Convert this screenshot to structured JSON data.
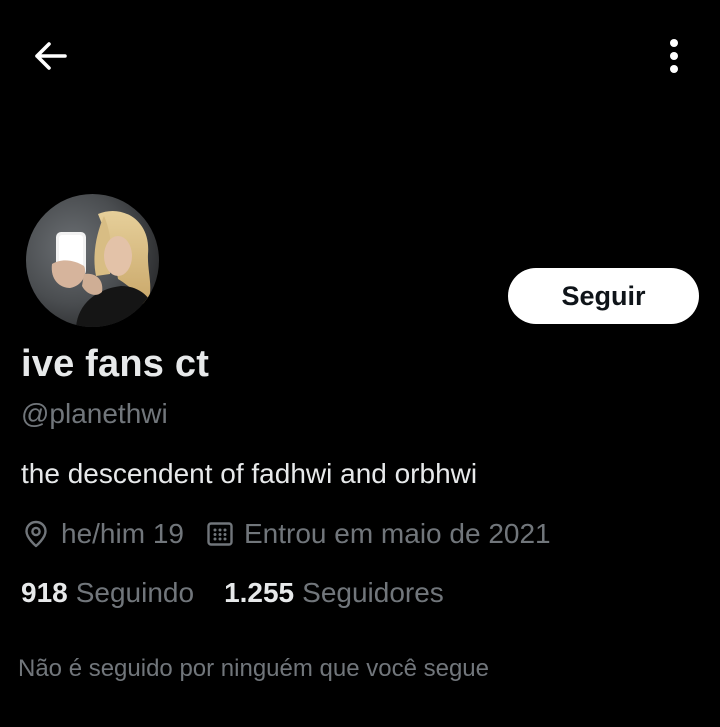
{
  "header": {
    "back_icon": "arrow-left-icon",
    "more_icon": "more-vertical-icon"
  },
  "profile": {
    "avatar_icon": "avatar",
    "follow_label": "Seguir",
    "display_name": "ive fans ct",
    "handle": "@planethwi",
    "bio": "the descendent of fadhwi and orbhwi",
    "location_icon": "location-pin-icon",
    "location": "he/him 19",
    "calendar_icon": "calendar-icon",
    "joined": "Entrou em maio de 2021",
    "following_count": "918",
    "following_label": "Seguindo",
    "followers_count": "1.255",
    "followers_label": "Seguidores",
    "followed_by_text": "Não é seguido por ninguém que você segue"
  },
  "colors": {
    "background": "#000000",
    "primary_text": "#e7e9ea",
    "secondary_text": "#71767b",
    "button_bg": "#ffffff",
    "button_text": "#0f1419"
  }
}
